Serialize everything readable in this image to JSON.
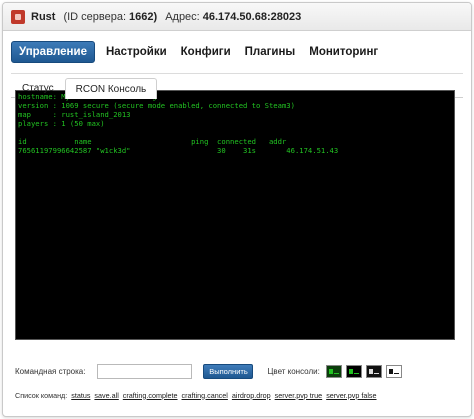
{
  "header": {
    "game": "Rust",
    "id_label": "(ID сервера:",
    "id_value": "1662)",
    "address_label": "Адрес:",
    "address_value": "46.174.50.68:28023"
  },
  "nav": [
    {
      "label": "Управление",
      "active": true
    },
    {
      "label": "Настройки",
      "active": false
    },
    {
      "label": "Конфиги",
      "active": false
    },
    {
      "label": "Плагины",
      "active": false
    },
    {
      "label": "Мониторинг",
      "active": false
    }
  ],
  "tabs": [
    {
      "label": "Статус",
      "active": false
    },
    {
      "label": "RCON Консоль",
      "active": true
    }
  ],
  "console": {
    "lines": [
      "hostname: MyArena.ru GameHosting",
      "version : 1069 secure (secure mode enabled, connected to Steam3)",
      "map     : rust_island_2013",
      "players : 1 (50 max)",
      "",
      "id           name                       ping  connected   addr",
      "76561197996642587 \"w1ck3d\"                    30    31s       46.174.51.43"
    ],
    "text_color": "#22c322",
    "background": "#000000"
  },
  "command": {
    "label": "Командная строка:",
    "input_value": "",
    "input_placeholder": "",
    "execute_label": "Выполнить",
    "color_label": "Цвет консоли:",
    "swatches": [
      {
        "bg": "#0b3d0b",
        "fg": "#22c322"
      },
      {
        "bg": "#000000",
        "fg": "#22c322"
      },
      {
        "bg": "#111111",
        "fg": "#dddddd"
      },
      {
        "bg": "#ffffff",
        "fg": "#111111"
      }
    ]
  },
  "command_list": {
    "label": "Список команд:",
    "commands": [
      "status",
      "save.all",
      "crafting.complete",
      "crafting.cancel",
      "airdrop.drop",
      "server.pvp true",
      "server.pvp false"
    ]
  }
}
